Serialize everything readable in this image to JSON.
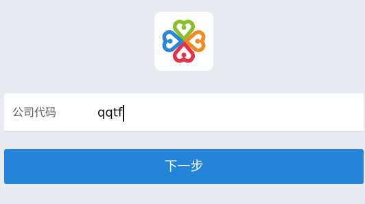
{
  "logo": {
    "icon": "clover-hearts-logo-icon",
    "colors": {
      "top": "#8bbf2e",
      "right": "#f08a24",
      "bottom": "#e0334a",
      "left": "#2a86d2"
    }
  },
  "form": {
    "company_code_label": "公司代码",
    "company_code_value": "qqtf"
  },
  "actions": {
    "next_label": "下一步"
  },
  "colors": {
    "background": "#e8ebf0",
    "primary_button": "#2584d8"
  }
}
